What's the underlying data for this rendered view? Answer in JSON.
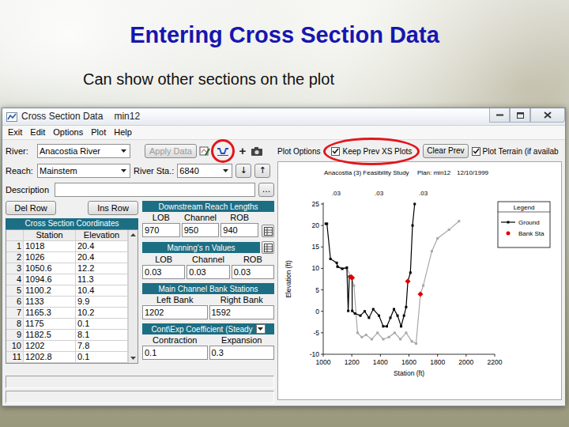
{
  "slide": {
    "title": "Entering Cross Section Data",
    "subtitle": "Can show other sections on the plot"
  },
  "window": {
    "title": "Cross Section Data",
    "plan": "min12"
  },
  "menu": [
    "Exit",
    "Edit",
    "Options",
    "Plot",
    "Help"
  ],
  "toolbar": {
    "river_label": "River:",
    "river_value": "Anacostia River",
    "apply": {
      "label": "Apply Data",
      "disabled": true
    },
    "tools": [
      {
        "kind": "icon",
        "highlighted": false
      },
      {
        "kind": "icon",
        "highlighted": true
      },
      {
        "kind": "text",
        "label": "+",
        "highlighted": false
      },
      {
        "kind": "icon",
        "highlighted": false
      }
    ],
    "reach_label": "Reach:",
    "reach_value": "Mainstem",
    "station_label": "River Sta.:",
    "station_value": "6840",
    "nav": [
      "↓",
      "↑"
    ],
    "description_label": "Description",
    "description_button": "..."
  },
  "plot_toolbar": {
    "options": "Plot Options",
    "clear": "Clear Prev",
    "checkboxes": [
      {
        "label": "Keep Prev XS Plots",
        "checked": true,
        "highlighted": true
      },
      {
        "label": "Plot Terrain (if availab",
        "checked": true,
        "highlighted": false
      }
    ]
  },
  "row_buttons": [
    "Del Row",
    "Ins Row"
  ],
  "coordinates": {
    "title": "Cross Section Coordinates",
    "columns": [
      "Station",
      "Elevation"
    ],
    "rows": [
      [
        "1",
        "1018",
        "20.4"
      ],
      [
        "2",
        "1026",
        "20.4"
      ],
      [
        "3",
        "1050.6",
        "12.2"
      ],
      [
        "4",
        "1094.6",
        "11.3"
      ],
      [
        "5",
        "1100.2",
        "10.4"
      ],
      [
        "6",
        "1133",
        "9.9"
      ],
      [
        "7",
        "1165.3",
        "10.2"
      ],
      [
        "8",
        "1175",
        "0.1"
      ],
      [
        "9",
        "1182.5",
        "8.1"
      ],
      [
        "10",
        "1202",
        "7.8"
      ],
      [
        "11",
        "1202.8",
        "0.1"
      ]
    ]
  },
  "sections": [
    {
      "title": "Downstream Reach Lengths",
      "kind": "values-button",
      "fields": [
        {
          "label": "LOB",
          "value": "970"
        },
        {
          "label": "Channel",
          "value": "950"
        },
        {
          "label": "ROB",
          "value": "940"
        }
      ]
    },
    {
      "title": "Manning's n Values",
      "kind": "header-button",
      "fields": [
        {
          "label": "LOB",
          "value": "0.03"
        },
        {
          "label": "Channel",
          "value": "0.03"
        },
        {
          "label": "ROB",
          "value": "0.03"
        }
      ]
    },
    {
      "title": "Main Channel Bank Stations",
      "kind": "plain",
      "fields": [
        {
          "label": "Left Bank",
          "value": "1202"
        },
        {
          "label": "Right Bank",
          "value": "1592"
        }
      ]
    },
    {
      "title": "Cont\\Exp Coefficient (Steady",
      "kind": "header-dropdown",
      "fields": [
        {
          "label": "Contraction",
          "value": "0.1"
        },
        {
          "label": "Expansion",
          "value": "0.3"
        }
      ]
    }
  ],
  "plot": {
    "title": "Anacostia (3) Feasibility Study",
    "plan": "Plan: min12",
    "date": "12/10/1999",
    "n_labels": [
      {
        "label": ".03",
        "station": 1090
      },
      {
        "label": ".03",
        "station": 1390
      },
      {
        "label": ".03",
        "station": 1700
      }
    ],
    "y_axis": {
      "label": "Elevation (ft)",
      "ticks": [
        "25",
        "20",
        "15",
        "10",
        "5",
        "0",
        "-5",
        "-10"
      ]
    },
    "x_axis": {
      "label": "Station (ft)",
      "ticks": [
        "1000",
        "1200",
        "1400",
        "1600",
        "1800",
        "2000",
        "2200"
      ]
    },
    "legend": {
      "title": "Legend",
      "items": [
        {
          "label": "Ground",
          "color": "#000000",
          "kind": "line"
        },
        {
          "label": "Bank Sta",
          "color": "#e00000",
          "kind": "dot"
        }
      ]
    },
    "series": [
      {
        "color": "#000000",
        "stations": [
          1018,
          1026,
          1050.6,
          1094.6,
          1100.2,
          1133,
          1165.3,
          1175,
          1182.5,
          1202,
          1202.8,
          1222,
          1260,
          1290,
          1320,
          1350,
          1390,
          1420,
          1445,
          1470,
          1495,
          1520,
          1545,
          1565,
          1580,
          1592,
          1610,
          1625,
          1640
        ],
        "elevations": [
          20.4,
          20.4,
          12.2,
          11.3,
          10.4,
          9.9,
          10.2,
          0.1,
          8.1,
          7.8,
          0.1,
          -0.5,
          -1,
          0,
          -1.5,
          0.5,
          -1,
          -3.5,
          -3.5,
          -1.5,
          0.5,
          -1,
          -3.5,
          -1,
          1,
          7,
          9,
          20,
          25
        ]
      },
      {
        "color": "#a8a8a8",
        "stations": [
          1100,
          1165,
          1195,
          1215,
          1240,
          1270,
          1300,
          1340,
          1380,
          1420,
          1460,
          1500,
          1540,
          1580,
          1620,
          1650,
          1680,
          1700,
          1760,
          1800,
          1880,
          1950
        ],
        "elevations": [
          10.4,
          10,
          8,
          6,
          -5,
          -6,
          -5.5,
          -6.5,
          -5,
          -6.5,
          -6,
          -5,
          -6.5,
          -5,
          -7,
          -7.5,
          4,
          6,
          14,
          17,
          19,
          21
        ]
      }
    ],
    "bank_points": {
      "color": "#e00000",
      "stations": [
        1195,
        1202,
        1592,
        1680
      ],
      "elevations": [
        8,
        7.8,
        7,
        4
      ]
    }
  }
}
